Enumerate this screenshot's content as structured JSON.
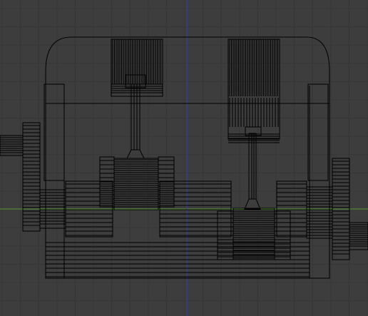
{
  "app": {
    "name": "3D viewport"
  },
  "view": {
    "mode": "wireframe",
    "background": "#3d3d3d",
    "grid_color": "#363636",
    "wire_color": "#000000",
    "x_axis_color": "#5a9a3a",
    "z_axis_color": "#3a3ab8"
  },
  "model": {
    "description_parts": [
      "engine-block",
      "piston-left",
      "piston-right",
      "connecting-rod-left",
      "connecting-rod-right",
      "crankshaft",
      "flywheel-left",
      "flywheel-right",
      "cylinder-head"
    ]
  }
}
